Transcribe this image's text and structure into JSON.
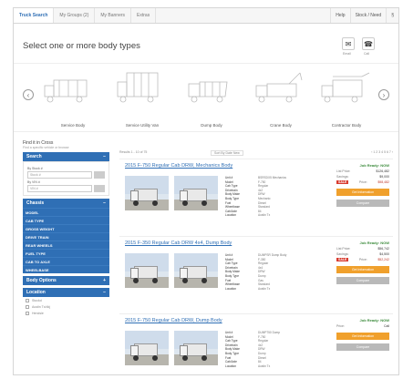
{
  "tabs": [
    {
      "label": "Truck Search",
      "active": true
    },
    {
      "label": "My Groups (2)",
      "active": false
    },
    {
      "label": "My Banners",
      "active": false
    },
    {
      "label": "Extras",
      "active": false
    }
  ],
  "top_right": [
    "Help",
    "Stock / Need",
    "§"
  ],
  "heading": "Select one or more body types",
  "header_icons": [
    {
      "icon": "email-icon",
      "glyph": "✉",
      "label": "Email"
    },
    {
      "icon": "phone-icon",
      "glyph": "☎",
      "label": "Call"
    }
  ],
  "body_types": [
    "Service Body",
    "Service Utility Van",
    "Dump Body",
    "Crane Body",
    "Contractor Body"
  ],
  "sidebar": {
    "title": "Find it in Cross",
    "subtitle": "Find a specific vehicle or browse",
    "search_header": "Search",
    "search_fields": [
      {
        "label": "By Stock #",
        "placeholder": "Stock #"
      },
      {
        "label": "By VIN #",
        "placeholder": "VIN #"
      }
    ],
    "chassis_header": "Chassis",
    "chassis_items": [
      "MODEL",
      "CAB TYPE",
      "GROSS WEIGHT",
      "DRIVE TRAIN",
      "REAR WHEELS",
      "FUEL TYPE",
      "CAB TO AXLE",
      "WHEELBASE"
    ],
    "body_options_header": "Body Options",
    "location_header": "Location",
    "locations": [
      "Stockd",
      "Austin Tx/dkj",
      "Hendsie"
    ]
  },
  "toolbar": {
    "results": "Results 1 - 10 of 75",
    "sort": "Sort By Date New",
    "pages": "‹ 1 2 3 4 5 6 7 ›"
  },
  "results": [
    {
      "title": "2015 F-750 Regular Cab DRW, Mechanics Body",
      "photos": 2,
      "specs": [
        [
          "Unit #",
          "BSRSDX5 Mechanics"
        ],
        [
          "Model",
          "F-750"
        ],
        [
          "Cab Type",
          "Regular"
        ],
        [
          "Drivetrain",
          "4x2"
        ],
        [
          "Body Make",
          "DRW"
        ],
        [
          "Body Type",
          "Mechanic"
        ],
        [
          "Fuel",
          "Diesel"
        ],
        [
          "Wheelbase",
          "Standard"
        ],
        [
          "Cab/Axle",
          "84"
        ],
        [
          "Location",
          "Austin Tx"
        ]
      ],
      "job_ready": "Job Ready: NOW",
      "prices": [
        {
          "k": "List Price:",
          "v": "$126,482",
          "sale": false
        },
        {
          "k": "Savings:",
          "v": "$9,000",
          "sale": false
        },
        {
          "k": "Price:",
          "v": "$98,482",
          "sale": true
        }
      ],
      "btn1": "Get Information",
      "btn2": "Compare"
    },
    {
      "title": "2015 F-350 Regular Cab DRW 4x4, Dump Body",
      "photos": 2,
      "specs": [
        [
          "Unit #",
          "DUMPSR Dump Body"
        ],
        [
          "Model",
          "F-350"
        ],
        [
          "Cab Type",
          "Regular"
        ],
        [
          "Drivetrain",
          "4x4"
        ],
        [
          "Body Make",
          "DRW"
        ],
        [
          "Body Type",
          "Dump"
        ],
        [
          "Fuel",
          "Gas"
        ],
        [
          "Wheelbase",
          "Standard"
        ],
        [
          "Location",
          "Austin Tx"
        ]
      ],
      "job_ready": "Job Ready: NOW",
      "prices": [
        {
          "k": "List Price:",
          "v": "$56,742",
          "sale": false
        },
        {
          "k": "Savings:",
          "v": "$4,500",
          "sale": false
        },
        {
          "k": "Price:",
          "v": "$52,242",
          "sale": true
        }
      ],
      "btn1": "Get Information",
      "btn2": "Compare"
    },
    {
      "title": "2015 F-750 Regular Cab DRW, Dump Body",
      "photos": 2,
      "specs": [
        [
          "Unit #",
          "DUMP750 Dump"
        ],
        [
          "Model",
          "F-750"
        ],
        [
          "Cab Type",
          "Regular"
        ],
        [
          "Drivetrain",
          "4x2"
        ],
        [
          "Body Make",
          "DRW"
        ],
        [
          "Body Type",
          "Dump"
        ],
        [
          "Fuel",
          "Diesel"
        ],
        [
          "Cab/Axle",
          "84"
        ],
        [
          "Location",
          "Austin Tx"
        ]
      ],
      "job_ready": "Job Ready: NOW",
      "prices": [
        {
          "k": "Price:",
          "v": "Call",
          "sale": false
        }
      ],
      "btn1": "Get Information",
      "btn2": "Compare"
    }
  ],
  "colors": {
    "accent": "#2f6fb5",
    "button_orange": "#f0a02c",
    "sale_red": "#d83b2f"
  }
}
